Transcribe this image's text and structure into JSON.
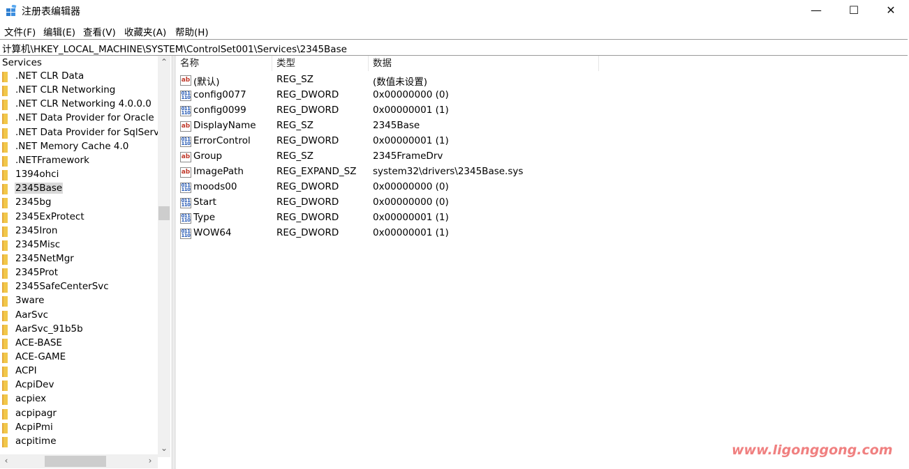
{
  "window": {
    "title": "注册表编辑器",
    "controls": {
      "minimize": "—",
      "maximize": "☐",
      "close": "✕"
    }
  },
  "menu": [
    "文件(F)",
    "编辑(E)",
    "查看(V)",
    "收藏夹(A)",
    "帮助(H)"
  ],
  "address": "计算机\\HKEY_LOCAL_MACHINE\\SYSTEM\\ControlSet001\\Services\\2345Base",
  "tree": {
    "root": "Services",
    "items": [
      ".NET CLR Data",
      ".NET CLR Networking",
      ".NET CLR Networking 4.0.0.0",
      ".NET Data Provider for Oracle",
      ".NET Data Provider for SqlServer",
      ".NET Memory Cache 4.0",
      ".NETFramework",
      "1394ohci",
      "2345Base",
      "2345bg",
      "2345ExProtect",
      "2345Iron",
      "2345Misc",
      "2345NetMgr",
      "2345Prot",
      "2345SafeCenterSvc",
      "3ware",
      "AarSvc",
      "AarSvc_91b5b",
      "ACE-BASE",
      "ACE-GAME",
      "ACPI",
      "AcpiDev",
      "acpiex",
      "acpipagr",
      "AcpiPmi",
      "acpitime"
    ],
    "selected_index": 8
  },
  "columns": {
    "name": "名称",
    "type": "类型",
    "data": "数据"
  },
  "values": [
    {
      "icon": "string-value-icon",
      "name": "(默认)",
      "type": "REG_SZ",
      "data": "(数值未设置)"
    },
    {
      "icon": "binary-value-icon",
      "name": "config0077",
      "type": "REG_DWORD",
      "data": "0x00000000 (0)"
    },
    {
      "icon": "binary-value-icon",
      "name": "config0099",
      "type": "REG_DWORD",
      "data": "0x00000001 (1)"
    },
    {
      "icon": "string-value-icon",
      "name": "DisplayName",
      "type": "REG_SZ",
      "data": "2345Base"
    },
    {
      "icon": "binary-value-icon",
      "name": "ErrorControl",
      "type": "REG_DWORD",
      "data": "0x00000001 (1)"
    },
    {
      "icon": "string-value-icon",
      "name": "Group",
      "type": "REG_SZ",
      "data": "2345FrameDrv"
    },
    {
      "icon": "string-value-icon",
      "name": "ImagePath",
      "type": "REG_EXPAND_SZ",
      "data": "system32\\drivers\\2345Base.sys"
    },
    {
      "icon": "binary-value-icon",
      "name": "moods00",
      "type": "REG_DWORD",
      "data": "0x00000000 (0)"
    },
    {
      "icon": "binary-value-icon",
      "name": "Start",
      "type": "REG_DWORD",
      "data": "0x00000000 (0)"
    },
    {
      "icon": "binary-value-icon",
      "name": "Type",
      "type": "REG_DWORD",
      "data": "0x00000001 (1)"
    },
    {
      "icon": "binary-value-icon",
      "name": "WOW64",
      "type": "REG_DWORD",
      "data": "0x00000001 (1)"
    }
  ],
  "icon_glyphs": {
    "sz": "ab",
    "bin": "011\n110"
  },
  "watermark": "www.ligonggong.com"
}
